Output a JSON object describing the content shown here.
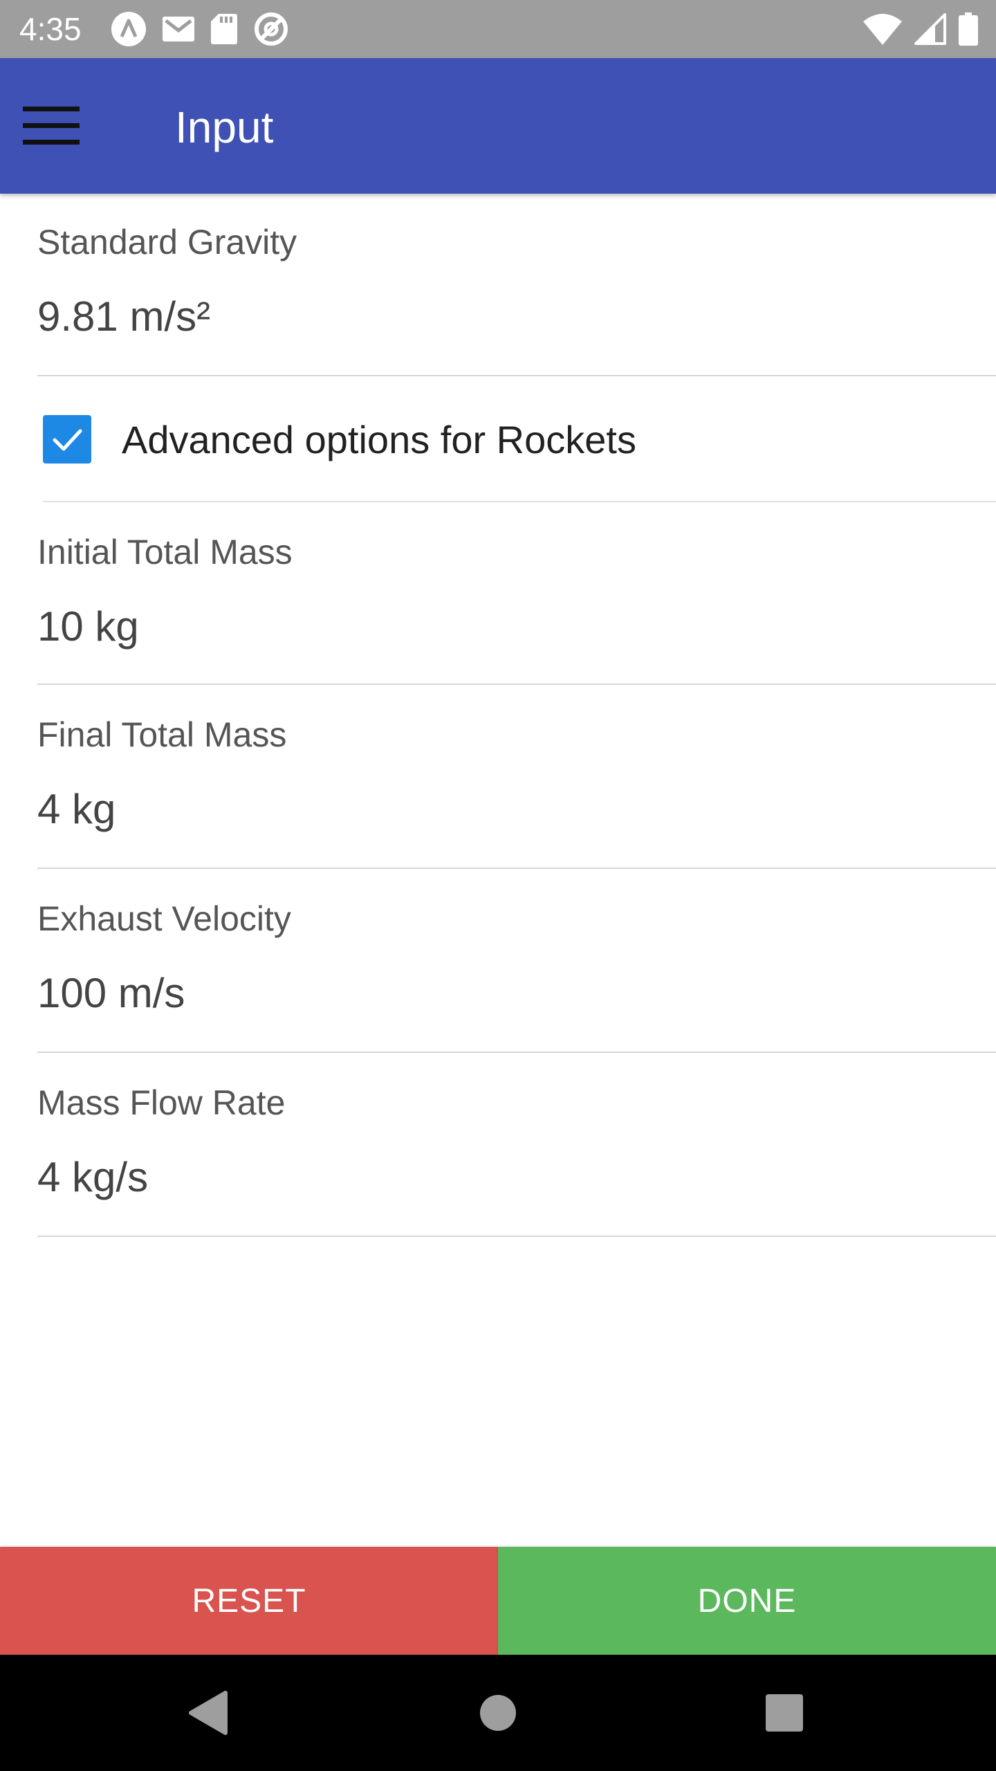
{
  "status_bar": {
    "time": "4:35",
    "left_icons": [
      "notification-a-icon",
      "gmail-icon",
      "sd-card-icon",
      "at-sign-icon"
    ],
    "right_icons": [
      "wifi-icon",
      "cellular-signal-icon",
      "battery-icon"
    ]
  },
  "app_bar": {
    "title": "Input",
    "menu_icon": "hamburger-menu-icon",
    "color": "#3f51b5"
  },
  "fields": {
    "standard_gravity": {
      "label": "Standard Gravity",
      "value": "9.81 m/s²"
    },
    "initial_total_mass": {
      "label": "Initial Total Mass",
      "value": "10 kg"
    },
    "final_total_mass": {
      "label": "Final Total Mass",
      "value": "4 kg"
    },
    "exhaust_velocity": {
      "label": "Exhaust Velocity",
      "value": "100 m/s"
    },
    "mass_flow_rate": {
      "label": "Mass Flow Rate",
      "value": "4 kg/s"
    }
  },
  "advanced_options": {
    "label": "Advanced options for Rockets",
    "checked": true,
    "accent": "#1e88e5"
  },
  "buttons": {
    "reset_label": "RESET",
    "reset_color": "#d9534f",
    "done_label": "DONE",
    "done_color": "#5cb85c"
  },
  "nav_bar": {
    "icons": [
      "back-icon",
      "home-icon",
      "recents-icon"
    ]
  }
}
